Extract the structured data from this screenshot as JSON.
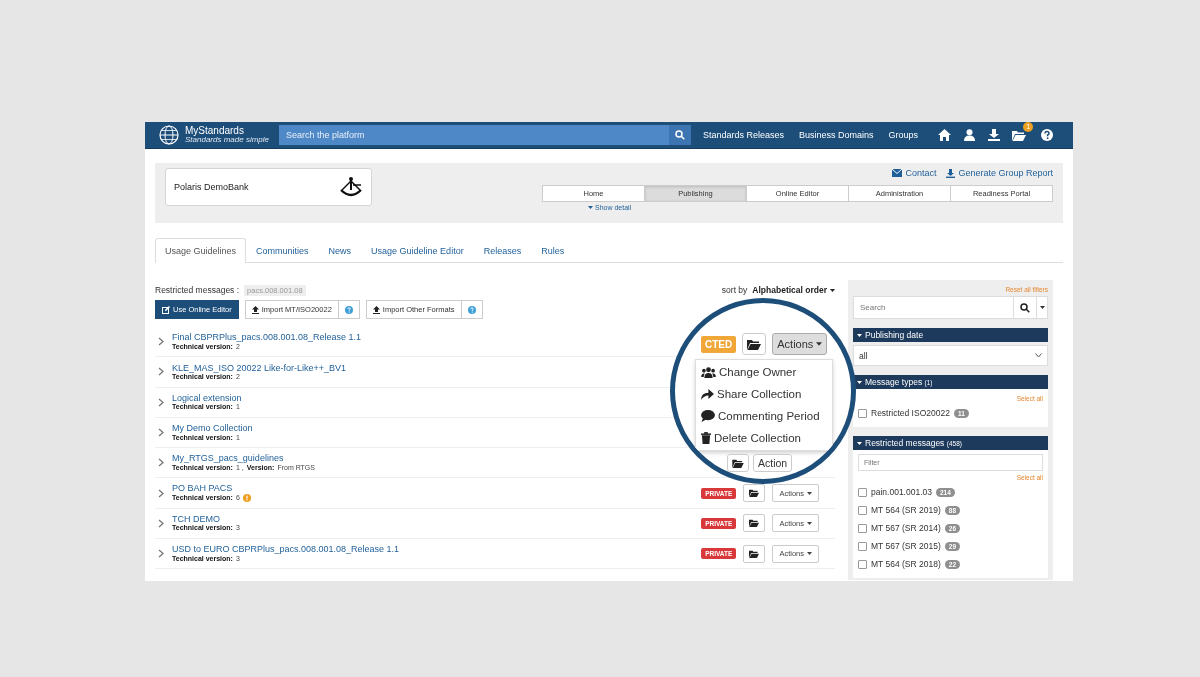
{
  "navbar": {
    "brand": "MyStandards",
    "tagline": "Standards made simple",
    "search_placeholder": "Search the platform",
    "links": [
      "Standards Releases",
      "Business Domains",
      "Groups"
    ],
    "notification_count": "1"
  },
  "group": {
    "name": "Polaris DemoBank",
    "contact": "Contact",
    "report": "Generate Group Report",
    "show_detail": "Show detail",
    "nav": [
      {
        "label": "Home",
        "selected": false
      },
      {
        "label": "Publishing",
        "selected": true
      },
      {
        "label": "Online Editor",
        "selected": false
      },
      {
        "label": "Administration",
        "selected": false
      },
      {
        "label": "Readiness Portal",
        "selected": false
      }
    ]
  },
  "tabs": [
    {
      "label": "Usage Guidelines",
      "selected": true
    },
    {
      "label": "Communities",
      "selected": false
    },
    {
      "label": "News",
      "selected": false
    },
    {
      "label": "Usage Guideline Editor",
      "selected": false
    },
    {
      "label": "Releases",
      "selected": false
    },
    {
      "label": "Rules",
      "selected": false
    }
  ],
  "restricted": {
    "label": "Restricted messages :",
    "tag": "pacs.008.001.08"
  },
  "toolbar": {
    "online_editor": "Use Online Editor",
    "import_mt": "Import MT/ISO20022",
    "import_other": "Import Other Formats"
  },
  "sort": {
    "label": "sort by",
    "value": "Alphabetical order"
  },
  "collections": [
    {
      "name": "Final CBPRPlus_pacs.008.001.08_Release 1.1",
      "tech_label": "Technical version:",
      "tech": "2",
      "warning": false
    },
    {
      "name": "KLE_MAS_ISO 20022 Like-for-Like++_BV1",
      "tech_label": "Technical version:",
      "tech": "2",
      "warning": false
    },
    {
      "name": "Logical extension",
      "tech_label": "Technical version:",
      "tech": "1",
      "warning": false
    },
    {
      "name": "My Demo Collection",
      "tech_label": "Technical version:",
      "tech": "1",
      "warning": false
    },
    {
      "name": "My_RTGS_pacs_guidelines",
      "tech_label": "Technical version:",
      "tech": "1 ,",
      "version_label": "Version:",
      "version": "From RTGS",
      "warning": false
    },
    {
      "name": "PO BAH PACS",
      "tech_label": "Technical version:",
      "tech": "6",
      "warning": true,
      "badge": "PRIVATE",
      "actions": "Actions"
    },
    {
      "name": "TCH DEMO",
      "tech_label": "Technical version:",
      "tech": "3",
      "warning": false,
      "badge": "PRIVATE",
      "actions": "Actions"
    },
    {
      "name": "USD to EURO CBPRPlus_pacs.008.001.08_Release 1.1",
      "tech_label": "Technical version:",
      "tech": "3",
      "warning": false,
      "badge": "PRIVATE",
      "actions": "Actions"
    }
  ],
  "magnifier": {
    "badge": "CTED",
    "actions": "Actions",
    "menu": [
      {
        "kind": "owner",
        "label": "Change Owner"
      },
      {
        "kind": "share",
        "label": "Share Collection"
      },
      {
        "kind": "comment",
        "label": "Commenting Period"
      },
      {
        "kind": "delete",
        "label": "Delete Collection"
      }
    ],
    "partial_action": "Action"
  },
  "sidebar": {
    "reset": "Reset all filters",
    "search_placeholder": "Search",
    "publishing_date": {
      "title": "Publishing date",
      "value": "all"
    },
    "message_types": {
      "title": "Message types",
      "count": "(1)",
      "select_all": "Select all",
      "items": [
        {
          "label": "Restricted ISO20022",
          "count": "11",
          "checked": false
        }
      ]
    },
    "restricted_messages": {
      "title": "Restricted messages",
      "count": "(458)",
      "filter_placeholder": "Filter",
      "select_all": "Select all",
      "items": [
        {
          "label": "pain.001.001.03",
          "count": "214",
          "checked": false
        },
        {
          "label": "MT 564 (SR 2019)",
          "count": "88",
          "checked": false
        },
        {
          "label": "MT 567 (SR 2014)",
          "count": "26",
          "checked": false
        },
        {
          "label": "MT 567 (SR 2015)",
          "count": "29",
          "checked": false
        },
        {
          "label": "MT 564 (SR 2018)",
          "count": "22",
          "checked": false
        }
      ]
    }
  }
}
